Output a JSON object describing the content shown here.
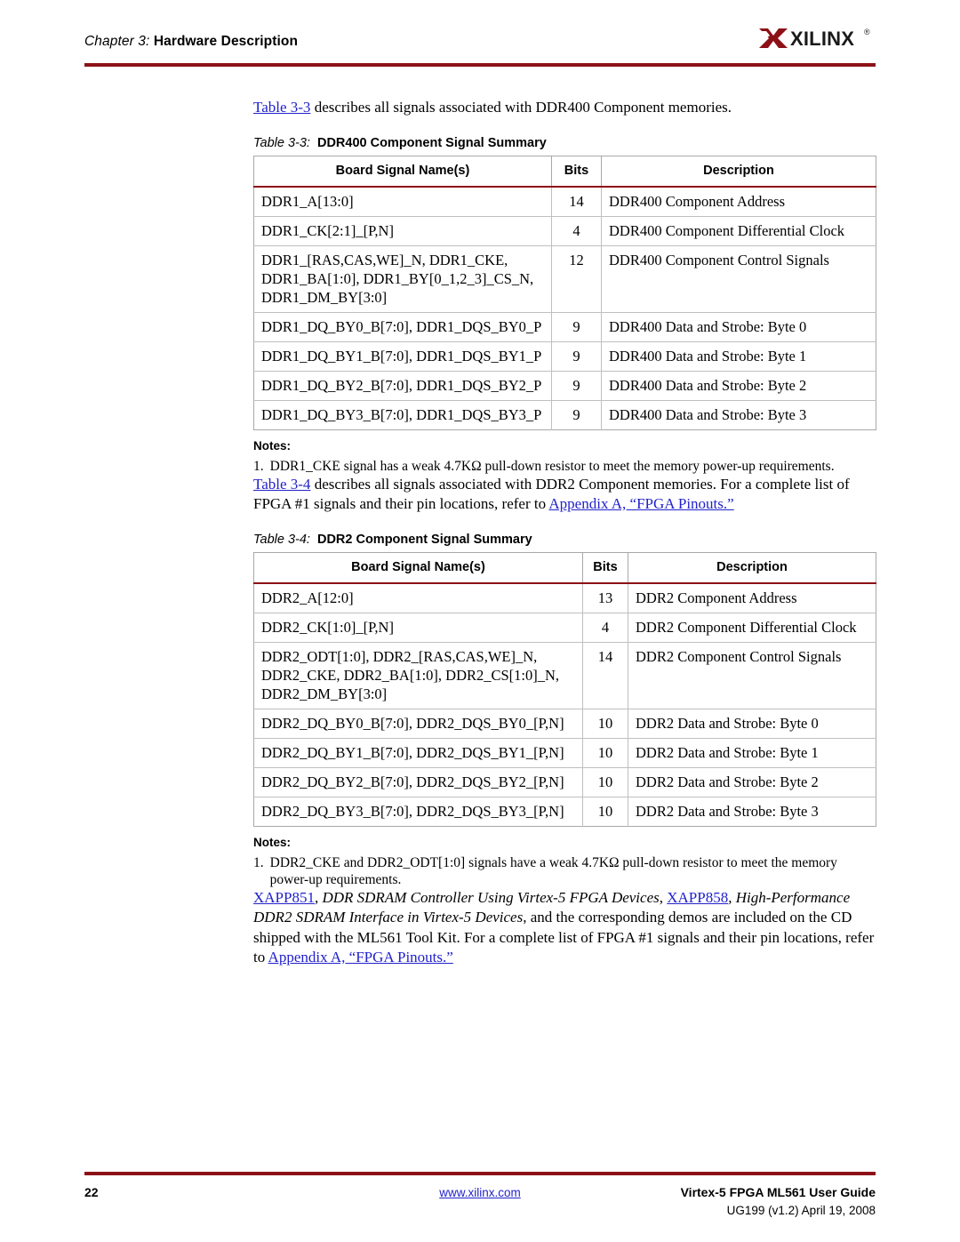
{
  "header": {
    "chapter_label": "Chapter 3:",
    "chapter_title": "Hardware Description",
    "rule_color": "#8c1117",
    "logo": {
      "name": "XILINX",
      "wordmark": "XILINX",
      "registered_mark": "®",
      "mark_color": "#8c1117"
    }
  },
  "intro": {
    "link": "Table 3-3",
    "rest": " describes all signals associated with DDR400 Component memories."
  },
  "table33": {
    "caption_label": "Table 3-3:",
    "caption_title": "DDR400 Component Signal Summary",
    "columns": [
      "Board Signal Name(s)",
      "Bits",
      "Description"
    ],
    "rows": [
      {
        "signal": "DDR1_A[13:0]",
        "bits": "14",
        "desc": "DDR400 Component Address"
      },
      {
        "signal": "DDR1_CK[2:1]_[P,N]",
        "bits": "4",
        "desc": "DDR400 Component Differential Clock"
      },
      {
        "signal": "DDR1_[RAS,CAS,WE]_N, DDR1_CKE, DDR1_BA[1:0], DDR1_BY[0_1,2_3]_CS_N, DDR1_DM_BY[3:0]",
        "bits": "12",
        "desc": "DDR400 Component Control Signals"
      },
      {
        "signal": "DDR1_DQ_BY0_B[7:0], DDR1_DQS_BY0_P",
        "bits": "9",
        "desc": "DDR400 Data and Strobe: Byte 0"
      },
      {
        "signal": "DDR1_DQ_BY1_B[7:0], DDR1_DQS_BY1_P",
        "bits": "9",
        "desc": "DDR400 Data and Strobe: Byte 1"
      },
      {
        "signal": "DDR1_DQ_BY2_B[7:0], DDR1_DQS_BY2_P",
        "bits": "9",
        "desc": "DDR400 Data and Strobe: Byte 2"
      },
      {
        "signal": "DDR1_DQ_BY3_B[7:0], DDR1_DQS_BY3_P",
        "bits": "9",
        "desc": "DDR400 Data and Strobe: Byte 3"
      }
    ],
    "notes_title": "Notes:",
    "notes": [
      {
        "num": "1.",
        "text": "DDR1_CKE signal has a weak 4.7KΩ pull-down resistor to meet the memory power-up requirements."
      }
    ]
  },
  "midtext": {
    "link": "Table 3-4",
    "part1": " describes all signals associated with DDR2 Component memories. For a complete list of FPGA #1 signals and their pin locations, refer to ",
    "link2": "Appendix A, “FPGA Pinouts.”"
  },
  "table34": {
    "caption_label": "Table 3-4:",
    "caption_title": "DDR2 Component Signal Summary",
    "columns": [
      "Board Signal Name(s)",
      "Bits",
      "Description"
    ],
    "rows": [
      {
        "signal": "DDR2_A[12:0]",
        "bits": "13",
        "desc": "DDR2 Component Address"
      },
      {
        "signal": "DDR2_CK[1:0]_[P,N]",
        "bits": "4",
        "desc": "DDR2 Component Differential Clock"
      },
      {
        "signal": "DDR2_ODT[1:0], DDR2_[RAS,CAS,WE]_N, DDR2_CKE, DDR2_BA[1:0], DDR2_CS[1:0]_N, DDR2_DM_BY[3:0]",
        "bits": "14",
        "desc": "DDR2 Component Control Signals"
      },
      {
        "signal": "DDR2_DQ_BY0_B[7:0], DDR2_DQS_BY0_[P,N]",
        "bits": "10",
        "desc": "DDR2 Data and Strobe: Byte 0"
      },
      {
        "signal": "DDR2_DQ_BY1_B[7:0], DDR2_DQS_BY1_[P,N]",
        "bits": "10",
        "desc": "DDR2 Data and Strobe: Byte 1"
      },
      {
        "signal": "DDR2_DQ_BY2_B[7:0], DDR2_DQS_BY2_[P,N]",
        "bits": "10",
        "desc": "DDR2 Data and Strobe: Byte 2"
      },
      {
        "signal": "DDR2_DQ_BY3_B[7:0], DDR2_DQS_BY3_[P,N]",
        "bits": "10",
        "desc": "DDR2 Data and Strobe: Byte 3"
      }
    ],
    "notes_title": "Notes:",
    "notes": [
      {
        "num": "1.",
        "text": "DDR2_CKE and DDR2_ODT[1:0] signals have a weak 4.7KΩ pull-down resistor to meet the memory power-up requirements."
      }
    ]
  },
  "closing": {
    "link1": "XAPP851",
    "ital1": ", DDR SDRAM Controller Using Virtex-5 FPGA Devices",
    "sep1": ", ",
    "link2": "XAPP858",
    "ital2": ", High-Performance DDR2 SDRAM Interface in Virtex-5 Devices",
    "plain": ", and the corresponding demos are included on the CD shipped with the ML561 Tool Kit. For a complete list of FPGA #1 signals and their pin locations, refer to ",
    "link3": "Appendix A, “FPGA Pinouts.”"
  },
  "footer": {
    "page_number": "22",
    "url": "www.xilinx.com",
    "doc_title": "Virtex-5 FPGA ML561 User Guide",
    "doc_id": "UG199 (v1.2) April 19, 2008",
    "rule_color": "#8c1117"
  }
}
